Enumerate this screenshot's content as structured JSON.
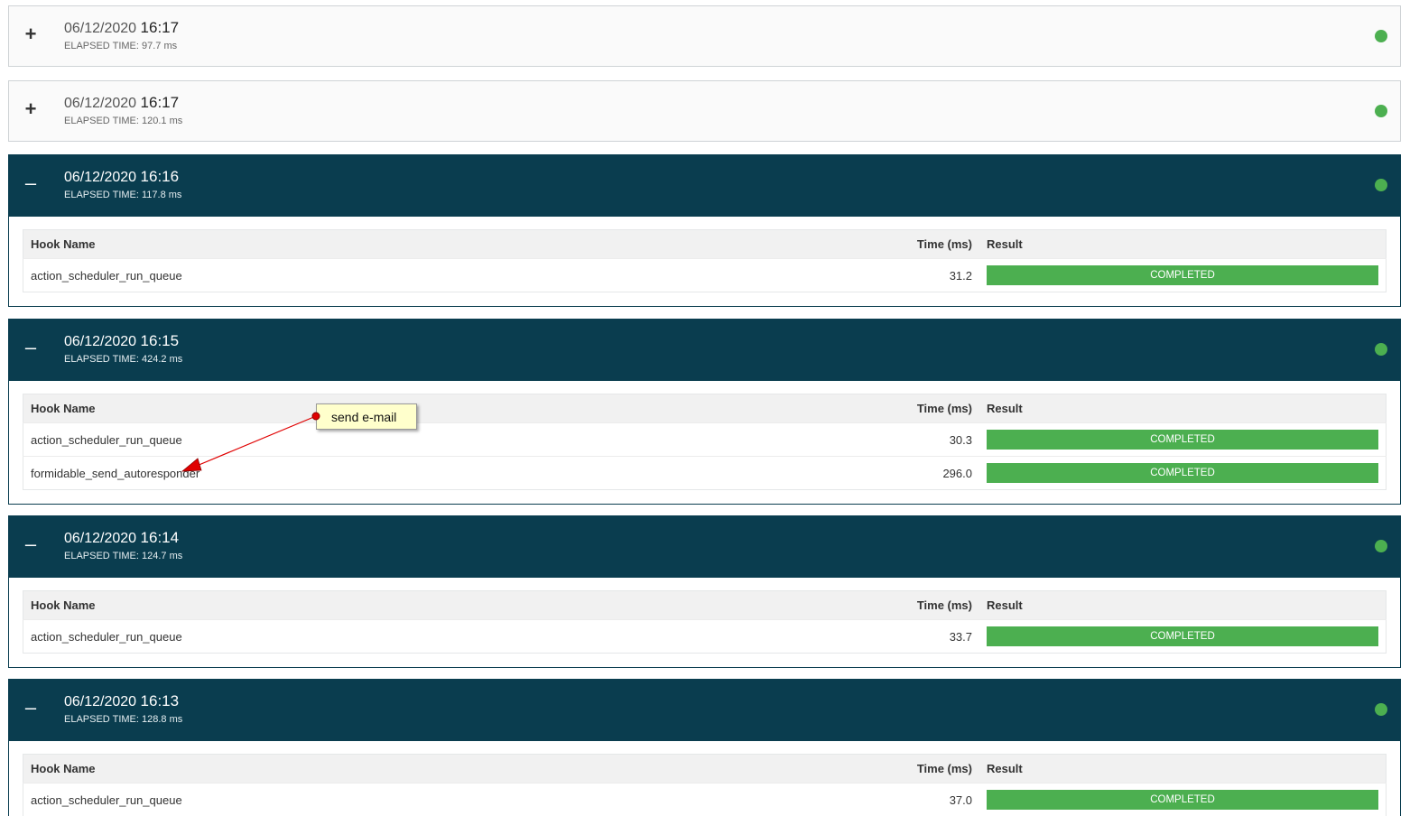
{
  "colors": {
    "header_open": "#0a3d4f",
    "status_ok": "#4caf50",
    "annotation_bg": "#ffffcc",
    "arrow": "#e00000"
  },
  "columns": {
    "hook_name": "Hook Name",
    "time": "Time (ms)",
    "result": "Result"
  },
  "runs": [
    {
      "toggle": "+",
      "date": "06/12/2020",
      "time": "16:17",
      "elapsed_label": "Elapsed time:",
      "elapsed_value": "97.7 ms",
      "expanded": false,
      "hooks": []
    },
    {
      "toggle": "+",
      "date": "06/12/2020",
      "time": "16:17",
      "elapsed_label": "Elapsed time:",
      "elapsed_value": "120.1 ms",
      "expanded": false,
      "hooks": []
    },
    {
      "toggle": "–",
      "date": "06/12/2020",
      "time": "16:16",
      "elapsed_label": "Elapsed time:",
      "elapsed_value": "117.8 ms",
      "expanded": true,
      "hooks": [
        {
          "name": "action_scheduler_run_queue",
          "time": "31.2",
          "result": "Completed"
        }
      ]
    },
    {
      "toggle": "–",
      "date": "06/12/2020",
      "time": "16:15",
      "elapsed_label": "Elapsed time:",
      "elapsed_value": "424.2 ms",
      "expanded": true,
      "hooks": [
        {
          "name": "action_scheduler_run_queue",
          "time": "30.3",
          "result": "Completed"
        },
        {
          "name": "formidable_send_autoresponder",
          "time": "296.0",
          "result": "Completed"
        }
      ]
    },
    {
      "toggle": "–",
      "date": "06/12/2020",
      "time": "16:14",
      "elapsed_label": "Elapsed time:",
      "elapsed_value": "124.7 ms",
      "expanded": true,
      "hooks": [
        {
          "name": "action_scheduler_run_queue",
          "time": "33.7",
          "result": "Completed"
        }
      ]
    },
    {
      "toggle": "–",
      "date": "06/12/2020",
      "time": "16:13",
      "elapsed_label": "Elapsed time:",
      "elapsed_value": "128.8 ms",
      "expanded": true,
      "hooks": [
        {
          "name": "action_scheduler_run_queue",
          "time": "37.0",
          "result": "Completed"
        }
      ]
    }
  ],
  "annotation": {
    "text": "send e-mail"
  }
}
